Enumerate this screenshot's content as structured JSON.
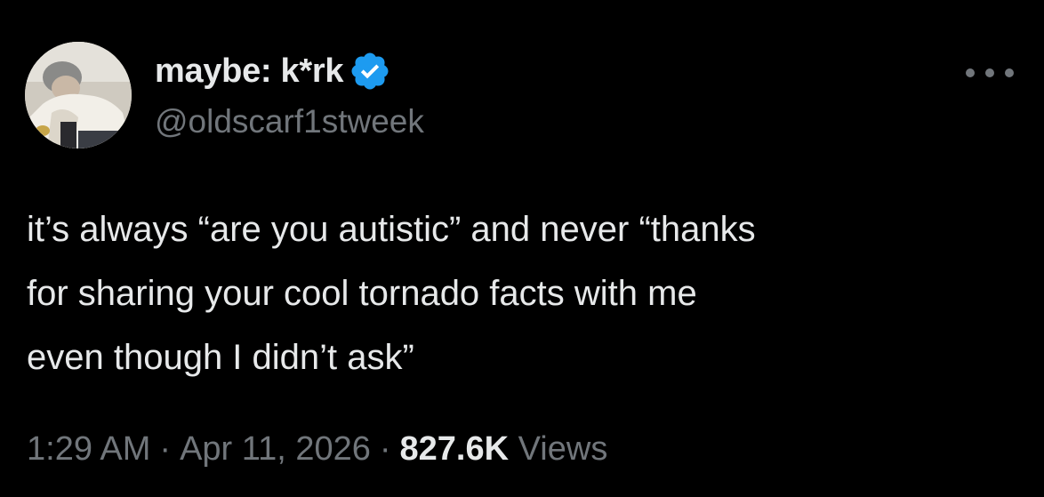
{
  "author": {
    "display_name": "maybe: k*rk",
    "handle": "@oldscarf1stweek",
    "verified": true,
    "verified_color": "#1d9bf0",
    "avatar_icon": "user-avatar-photo"
  },
  "more_icon": "more-options-icon",
  "tweet": {
    "lines": [
      "it’s always “are you autistic” and never “thanks",
      "for sharing your cool tornado facts with me",
      "even though I didn’t ask”"
    ]
  },
  "meta": {
    "time": "1:29 AM",
    "date": "Apr 11, 2026",
    "separator": "·",
    "views_count": "827.6K",
    "views_label": "Views"
  },
  "colors": {
    "background": "#000000",
    "primary_text": "#e7e9ea",
    "secondary_text": "#71767b",
    "accent": "#1d9bf0"
  }
}
